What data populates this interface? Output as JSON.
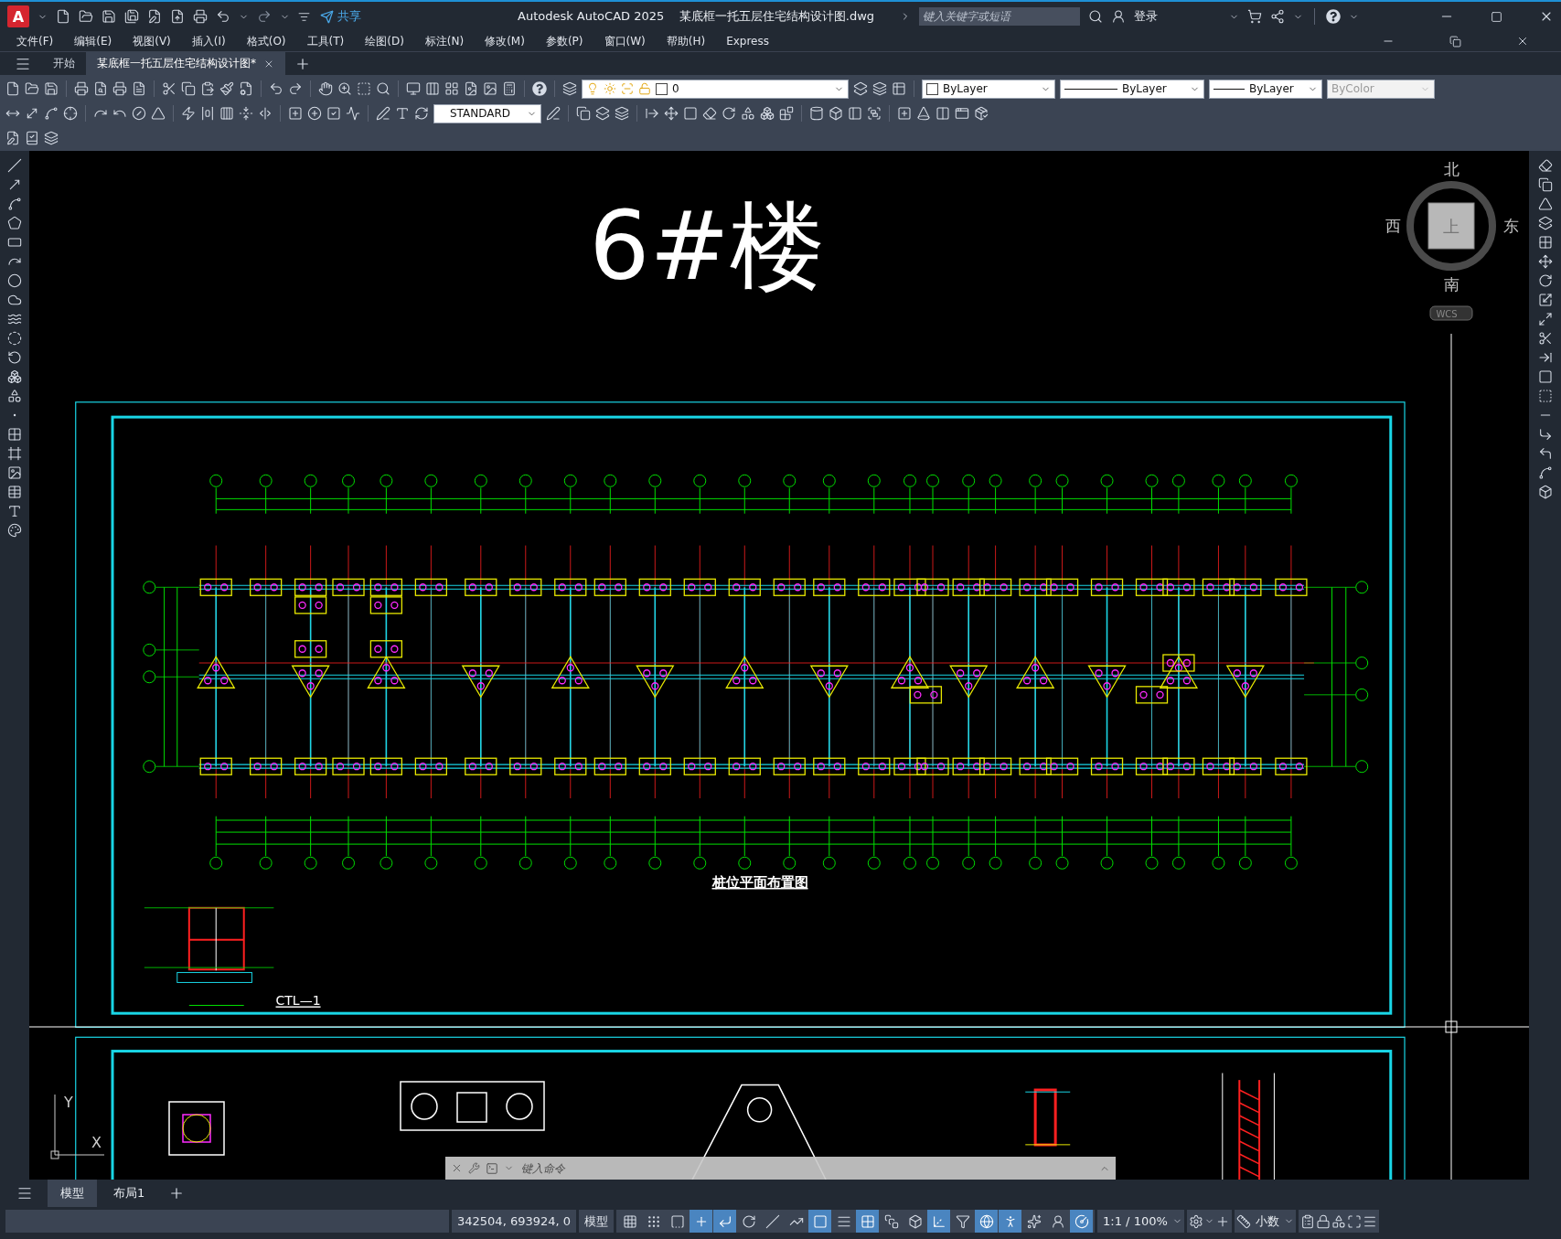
{
  "title_bar": {
    "logo": "A",
    "share": "共享",
    "app_title": "Autodesk AutoCAD 2025",
    "file_name": "某底框一托五层住宅结构设计图.dwg",
    "search": {
      "placeholder": "键入关键字或短语"
    },
    "sign_in": "登录"
  },
  "menu_bar": [
    "文件(F)",
    "编辑(E)",
    "视图(V)",
    "插入(I)",
    "格式(O)",
    "工具(T)",
    "绘图(D)",
    "标注(N)",
    "修改(M)",
    "参数(P)",
    "窗口(W)",
    "帮助(H)",
    "Express"
  ],
  "file_tabs": [
    {
      "label": "开始",
      "selected": false
    },
    {
      "label": "某底框一托五层住宅结构设计图*",
      "selected": true
    }
  ],
  "toolbar": {
    "layer": "0",
    "text_style": "STANDARD",
    "color_control": "ByLayer",
    "linetype": "ByLayer",
    "lineweight": "ByLayer",
    "plot_style": {
      "value": "ByColor",
      "disabled": true
    }
  },
  "drawing": {
    "title": "6#楼",
    "plan_title": "桩位平面布置图",
    "detail_label": "CTL—1"
  },
  "view_cube": {
    "north": "北",
    "south": "南",
    "west": "西",
    "east": "东",
    "face": "上",
    "ucs": "WCS"
  },
  "ucs_icon": {
    "x": "X",
    "y": "Y"
  },
  "command_line": {
    "placeholder": "键入命令"
  },
  "layout_tabs": [
    {
      "label": "模型",
      "selected": true
    },
    {
      "label": "布局1",
      "selected": false
    }
  ],
  "status_bar": {
    "coordinates": "342504, 693924, 0",
    "space": "模型",
    "scale": "1:1 / 100%",
    "units": "小数",
    "toggles": [
      {
        "on": false
      },
      {
        "on": false
      },
      {
        "on": false
      },
      {
        "on": true
      },
      {
        "on": true
      },
      {
        "on": false
      },
      {
        "on": false
      },
      {
        "on": false
      },
      {
        "on": true
      },
      {
        "on": false
      },
      {
        "on": true
      },
      {
        "on": false
      },
      {
        "on": false
      },
      {
        "on": true
      },
      {
        "on": false
      },
      {
        "on": true
      },
      {
        "on": true
      },
      {
        "on": false
      },
      {
        "on": false
      },
      {
        "on": true
      }
    ]
  }
}
